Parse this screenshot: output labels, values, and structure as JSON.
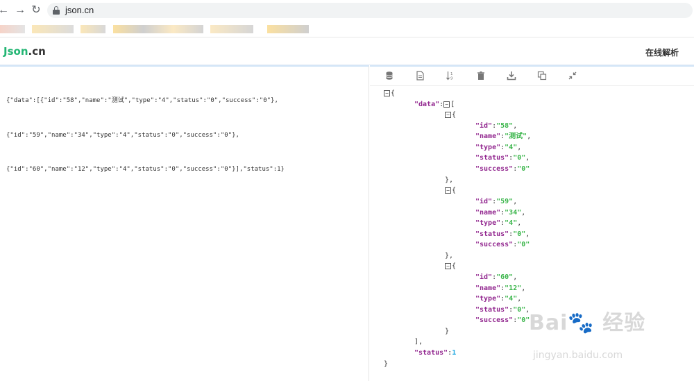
{
  "browser": {
    "url": "json.cn"
  },
  "header": {
    "logo_j": "Json",
    "logo_dot": ".",
    "logo_cn": "cn",
    "nav_link": "在线解析"
  },
  "editor": {
    "raw_lines": [
      "{\"data\":[{\"id\":\"58\",\"name\":\"测试\",\"type\":\"4\",\"status\":\"0\",\"success\":\"0\"},",
      "{\"id\":\"59\",\"name\":\"34\",\"type\":\"4\",\"status\":\"0\",\"success\":\"0\"},",
      "{\"id\":\"60\",\"name\":\"12\",\"type\":\"4\",\"status\":\"0\",\"success\":\"0\"}],\"status\":1}"
    ]
  },
  "toolbar": {
    "icons": [
      "database-icon",
      "file-icon",
      "sort-icon",
      "trash-icon",
      "download-icon",
      "copy-icon",
      "compress-icon"
    ]
  },
  "tree": {
    "root_open": "{",
    "root_close": "}",
    "data_key": "\"data\"",
    "status_key": "\"status\"",
    "status_value": "1",
    "items": [
      {
        "id": "\"58\"",
        "name": "\"测试\"",
        "type": "\"4\"",
        "status": "\"0\"",
        "success": "\"0\""
      },
      {
        "id": "\"59\"",
        "name": "\"34\"",
        "type": "\"4\"",
        "status": "\"0\"",
        "success": "\"0\""
      },
      {
        "id": "\"60\"",
        "name": "\"12\"",
        "type": "\"4\"",
        "status": "\"0\"",
        "success": "\"0\""
      }
    ]
  },
  "watermark": {
    "main": "Bai🐾 经验",
    "sub": "jingyan.baidu.com"
  },
  "colors": {
    "key": "#92278f",
    "string": "#3ab54a",
    "number": "#25aae2",
    "logo": "#22b573"
  }
}
